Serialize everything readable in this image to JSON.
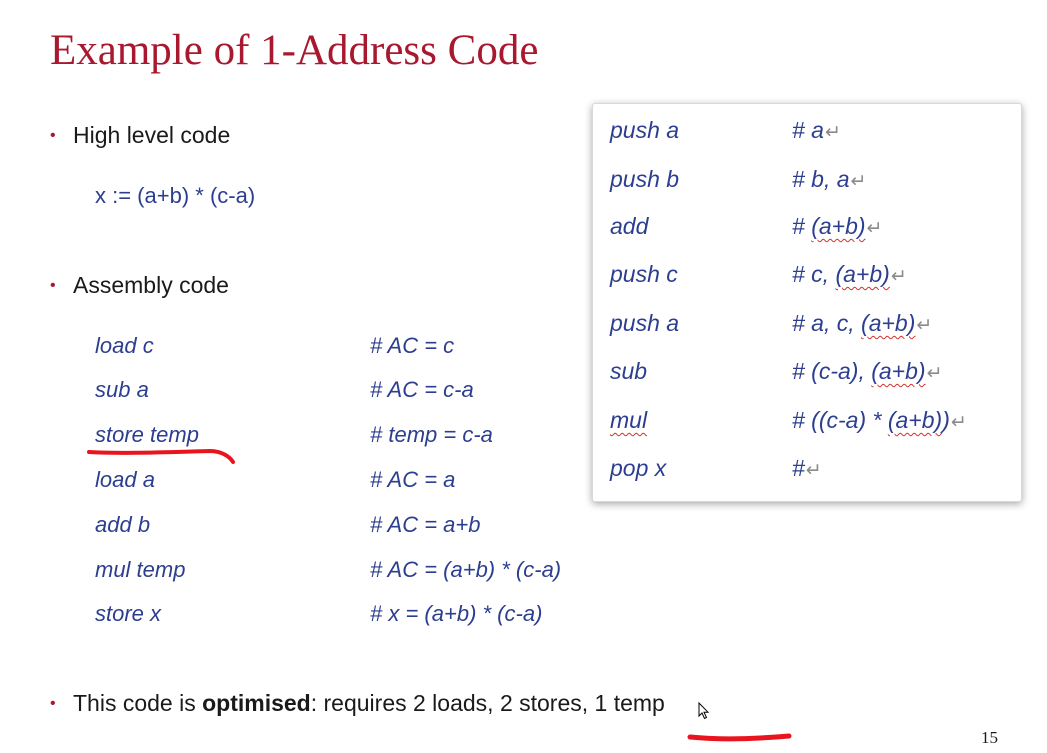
{
  "title": "Example of 1-Address Code",
  "bullets": {
    "high_level": "High level code",
    "high_level_code": "x := (a+b) * (c-a)",
    "assembly": "Assembly code",
    "summary_prefix": "This code is ",
    "summary_bold": "optimised",
    "summary_suffix": ": requires 2 loads, 2 stores, 1 temp"
  },
  "assembly_code": [
    {
      "instr": "load c",
      "comment": "# AC = c"
    },
    {
      "instr": "sub a",
      "comment": "# AC = c-a"
    },
    {
      "instr": "store temp",
      "comment": "# temp = c-a"
    },
    {
      "instr": "load a",
      "comment": "# AC = a"
    },
    {
      "instr": "add b",
      "comment": "# AC = a+b"
    },
    {
      "instr": "mul temp",
      "comment": "# AC = (a+b) * (c-a)"
    },
    {
      "instr": "store x",
      "comment": "# x = (a+b) * (c-a)"
    }
  ],
  "stack_code": [
    {
      "instr": "push a",
      "comment_pre": "# a",
      "spell": "",
      "comment_post": ""
    },
    {
      "instr": "push b",
      "comment_pre": "# b, a",
      "spell": "",
      "comment_post": ""
    },
    {
      "instr": "add",
      "comment_pre": "# ",
      "spell": "(a+b)",
      "comment_post": ""
    },
    {
      "instr": "push c",
      "comment_pre": "# c, ",
      "spell": "(a+b)",
      "comment_post": ""
    },
    {
      "instr": "push a",
      "comment_pre": "# a, c, ",
      "spell": "(a+b)",
      "comment_post": ""
    },
    {
      "instr": "sub",
      "comment_pre": "# (c-a), ",
      "spell": "(a+b)",
      "comment_post": ""
    },
    {
      "instr": "mul",
      "comment_pre": "# ((c-a) * ",
      "spell": "(a+b)",
      "comment_post": ")"
    },
    {
      "instr": "pop x",
      "comment_pre": "#",
      "spell": "",
      "comment_post": ""
    }
  ],
  "paragraph_mark": "↵",
  "page_number": "15",
  "colors": {
    "title": "#a8182e",
    "code": "#2c3e90",
    "annotation": "#e8141e"
  },
  "icons": {
    "bullet": "bullet-dot-icon",
    "paragraph": "paragraph-mark-icon",
    "cursor": "mouse-cursor-icon"
  }
}
